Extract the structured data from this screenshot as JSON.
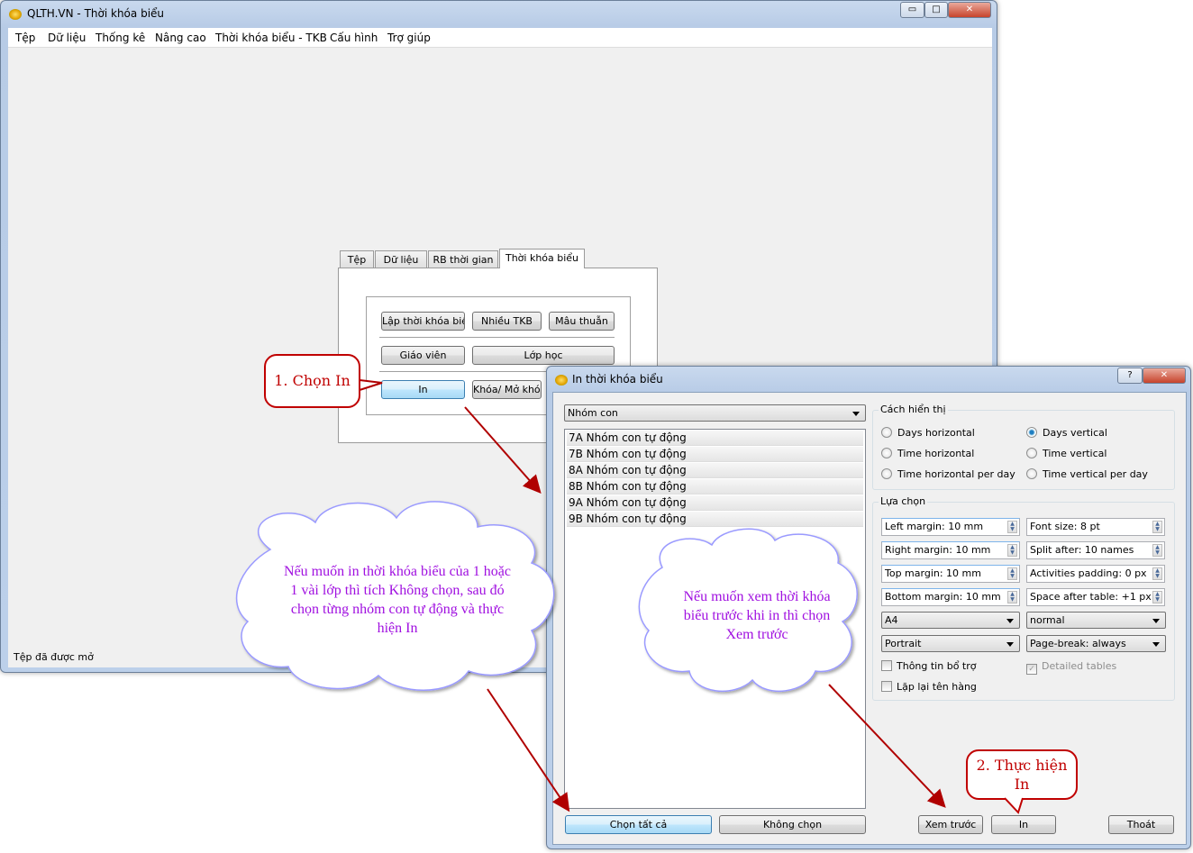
{
  "main_window": {
    "title": "QLTH.VN - Thời khóa biểu",
    "controls": {
      "minimize": "▭",
      "maximize": "□",
      "close": "✕"
    },
    "menu": [
      "Tệp",
      "Dữ liệu",
      "Thống kê",
      "Nâng cao",
      "Thời khóa biểu - TKB",
      "Cấu hình",
      "Trợ giúp"
    ],
    "status": "Tệp đã được mở"
  },
  "panel": {
    "tabs": [
      "Tệp",
      "Dữ liệu",
      "RB thời gian",
      "Thời khóa biểu"
    ],
    "active_tab": "Thời khóa biểu",
    "buttons": {
      "lap_tkb": "Lập thời khóa biểu",
      "nhieu_tkb": "Nhiều TKB",
      "mau_thuan": "Mâu thuẫn",
      "giao_vien": "Giáo viên",
      "lop_hoc": "Lớp học",
      "in": "In",
      "khoa": "Khóa/ Mở khóa"
    }
  },
  "dialog": {
    "title": "In thời khóa biểu",
    "help": "?",
    "close": "✕",
    "group_combo": "Nhóm con",
    "list_items": [
      "7A Nhóm con tự động",
      "7B Nhóm con tự động",
      "8A Nhóm con tự động",
      "8B Nhóm con tự động",
      "9A Nhóm con tự động",
      "9B Nhóm con tự động"
    ],
    "display_group": {
      "label": "Cách hiển thị",
      "options": [
        "Days horizontal",
        "Days vertical",
        "Time horizontal",
        "Time vertical",
        "Time horizontal per day",
        "Time vertical per day"
      ],
      "selected": "Days vertical"
    },
    "options_group": {
      "label": "Lựa chọn",
      "spins": [
        "Left margin: 10 mm",
        "Font size: 8 pt",
        "Right margin: 10 mm",
        "Split after: 10 names",
        "Top margin: 10 mm",
        "Activities padding: 0 px",
        "Bottom margin: 10 mm",
        "Space after table: +1 px"
      ],
      "combos": [
        "A4",
        "normal",
        "Portrait",
        "Page-break: always"
      ],
      "checks": {
        "thong_tin": "Thông tin bổ trợ",
        "detailed": "Detailed tables",
        "lap_lai": "Lặp lại tên hàng"
      },
      "checked": {
        "thong_tin": false,
        "detailed": true,
        "lap_lai": false
      }
    },
    "buttons": {
      "select_all": "Chọn tất cả",
      "select_none": "Không chọn",
      "preview": "Xem trước",
      "print": "In",
      "exit": "Thoát"
    }
  },
  "annotations": {
    "callout1": "1. Chọn In",
    "callout2": "2. Thực hiện In",
    "cloud1": "Nếu muốn in thời khóa biểu của 1 hoặc 1 vài lớp thì tích Không chọn, sau đó chọn từng nhóm con tự động và thực hiện In",
    "cloud2": "Nếu muốn xem thời khóa biểu trước khi in thì chọn Xem trước",
    "arrow_color": "#b00000",
    "cloud_border": "#9a9aff",
    "cloud_text_color": "#a010e0"
  }
}
